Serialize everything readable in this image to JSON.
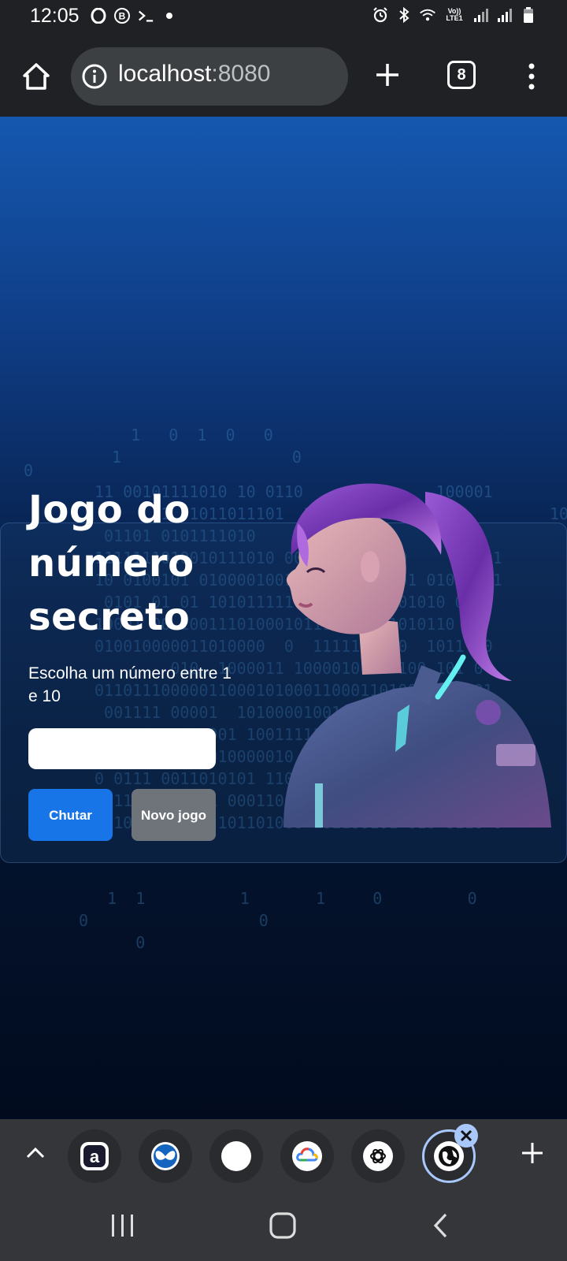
{
  "status_bar": {
    "time": "12:05",
    "left_icons": [
      "opera-icon",
      "b-icon",
      "terminal-icon",
      "dot-icon"
    ],
    "right_icons": [
      "alarm-icon",
      "bluetooth-icon",
      "wifi-icon",
      "volte-icon",
      "signal-icon",
      "signal-icon",
      "battery-icon"
    ],
    "volte_label": "Vo)) LTE1"
  },
  "browser": {
    "url_host": "localhost",
    "url_port": ":8080",
    "tab_count": "8"
  },
  "page": {
    "title": "Jogo do número secreto",
    "subtitle": "Escolha um número entre 1 e 10",
    "input_value": "",
    "guess_button": "Chutar",
    "new_game_button": "Novo jogo",
    "accent_color": "#1875e8",
    "secondary_color": "#6f737a"
  },
  "tab_strip": {
    "tabs": [
      {
        "icon": "a-app-icon"
      },
      {
        "icon": "butterfly-icon"
      },
      {
        "icon": "blank-icon"
      },
      {
        "icon": "google-cloud-icon"
      },
      {
        "icon": "openai-icon"
      },
      {
        "icon": "globe-icon",
        "active": true
      }
    ]
  }
}
